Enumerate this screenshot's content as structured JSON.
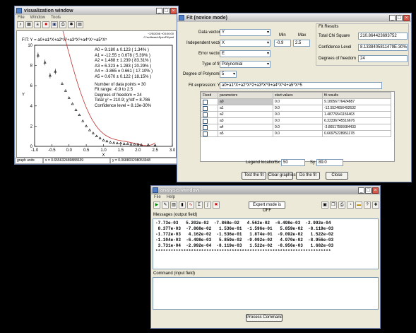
{
  "viz": {
    "title": "visualization window",
    "menu": [
      "File",
      "Window",
      "Tools"
    ],
    "fit_label": "FIT: Y = a0+a1*X+a2*X²+a3*X³+a4*X⁴+a5*X⁵",
    "stamp_line1": "~2/5/2008 +03:00:00",
    "stamp_line2": "C:\\software\\SpecFit\\pad",
    "params": [
      "A0 = 9.180 ± 0.123 ( 1.34% )",
      "A1 = -12.55 ± 0.678 ( 5.39% )",
      "A2 = 1.488 ± 1.239 ( 83.31% )",
      "A3 = 6.323 ± 1.283 ( 20.29% )",
      "A4 = -3.865 ± 0.661 ( 17.10% )",
      "A5 = 0.670 ± 0.122 ( 18.15% )"
    ],
    "stats": [
      "Number of data points = 30",
      "Fit range: -0.9 to 2.5",
      "Degrees of freedom = 24",
      "Total χ² = 210.9;  χ²/df = 8.786",
      "Confidence level = 8.13e-30%"
    ],
    "status_left": "graph units",
    "status_x": "x = 0.655632489888639",
    "status_y": "y = 0.068803298053948"
  },
  "chart_data": {
    "type": "scatter",
    "xlabel": "X",
    "ylabel": "Y",
    "xlim": [
      -1.0,
      3.0
    ],
    "ylim": [
      0,
      10
    ],
    "x_ticks": [
      "-1.0",
      "-0.5",
      "0.0",
      "0.5",
      "1.0",
      "1.5",
      "2.0",
      "2.5",
      "3.0"
    ],
    "y_ticks": [
      "0",
      "2",
      "4",
      "6",
      "8",
      "10"
    ],
    "series": [
      {
        "x": [
          -0.9,
          -0.7,
          -0.55,
          -0.4,
          -0.2,
          -0.1,
          0.0,
          0.1,
          0.2,
          0.3,
          0.4,
          0.5,
          0.6,
          0.7,
          0.8,
          0.9,
          1.0,
          1.1,
          1.2,
          1.3,
          1.4,
          1.5,
          1.6,
          1.7,
          1.8,
          1.9,
          2.0,
          2.1,
          2.3,
          2.5
        ],
        "y": [
          9.0,
          8.3,
          7.0,
          7.4,
          6.2,
          5.5,
          4.8,
          4.2,
          3.6,
          3.1,
          2.5,
          2.0,
          1.6,
          1.3,
          1.0,
          0.8,
          0.6,
          0.5,
          0.4,
          0.35,
          0.3,
          0.3,
          0.25,
          0.25,
          0.2,
          0.2,
          0.2,
          0.15,
          0.15,
          0.1
        ]
      }
    ]
  },
  "fit": {
    "title": "Fit  (novice mode)",
    "data_vector_label": "Data vector",
    "data_vector": "Y",
    "indep_label": "Independent vector",
    "indep": "X",
    "error_label": "Error vector",
    "error": "E",
    "type_label": "Type of fit",
    "type": "Polynomial",
    "degree_label": "Degree of Polynomial",
    "degree": "5",
    "min_label": "Min",
    "max_label": "Max",
    "min": "-0.9",
    "max": "2.5",
    "expr_label": "Fit expression:  Y =",
    "expr": "a0+a1*X+a2*X^2+a3*X^3+a4*X^4+a5*X^5",
    "results_title": "Fit Results",
    "chi_label": "Total Chi Square",
    "chi": "210.864423693752",
    "conf_label": "Confidence Level",
    "conf": "8.1338405811479E-30%",
    "dof_label": "Degrees of freedom",
    "dof": "24",
    "table_headers": [
      "Fixed",
      "parameters",
      "start values",
      "fit results"
    ],
    "rows": [
      {
        "p": "a0",
        "s": "0.0",
        "r": "9.18056776424887"
      },
      {
        "p": "a1",
        "s": "0.0",
        "r": "-12.5524656492632"
      },
      {
        "p": "a2",
        "s": "0.0",
        "r": "1.48776541156463"
      },
      {
        "p": "a3",
        "s": "0.0",
        "r": "6.32336745516676"
      },
      {
        "p": "a4",
        "s": "0.0",
        "r": "-3.86517566684433"
      },
      {
        "p": "a5",
        "s": "0.0",
        "r": "0.66975228951178"
      }
    ],
    "legend_label": "Legend location",
    "sx_label": "Sx",
    "sx": "50",
    "sy_label": "Sy",
    "sy": "89.0",
    "buttons": [
      "Test the fit",
      "Clear graphics",
      "Do the fit",
      "Close"
    ]
  },
  "analysis": {
    "title": "analysis window",
    "menu": [
      "File",
      "Help"
    ],
    "expert": "Expert mode is OFF",
    "messages_label": "Messages (output field)",
    "messages": [
      "-7.73e-03   5.202e-02  -7.868e-02   4.562e-02  -6.498e-03  -2.992e-04",
      " 8.377e-03  -7.868e-02   1.536e-01  -1.596e-01   5.859e-02  -8.119e-03",
      "-1.772e-03   4.162e-02  -1.536e-01   1.874e-01  -9.092e-02   1.522e-02",
      "-1.104e-03  -6.498e-03   5.859e-02  -9.092e-02   4.970e-02  -8.956e-03",
      " 3.731e-04  -2.992e-04  -8.119e-03   1.522e-02  -8.956e-03   1.682e-03",
      "",
      "*********************************************************************"
    ],
    "command_label": "Command (input field)",
    "process": "Process Command"
  }
}
